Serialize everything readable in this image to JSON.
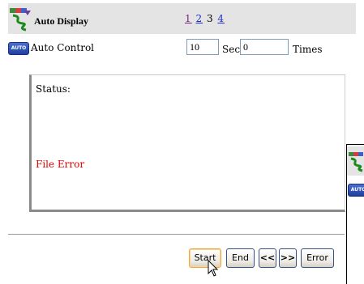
{
  "header": {
    "title": "Auto Display",
    "pages": [
      "1",
      "2",
      "3",
      "4"
    ],
    "current_page": "3"
  },
  "auto_control": {
    "badge": "AUTO",
    "label": "Auto Control",
    "interval_value": "10",
    "interval_unit": "Sec",
    "times_value": "0",
    "times_unit": "Times"
  },
  "status": {
    "label": "Status:",
    "message": "File Error",
    "message_color": "#e00000"
  },
  "buttons": {
    "start": "Start",
    "end": "End",
    "prev": "<<",
    "next": ">>",
    "error": "Error"
  },
  "side_window": {
    "badge": "AUTO"
  },
  "icons": {
    "app": "auto-display-icon",
    "cursor": "mouse-pointer-icon"
  }
}
